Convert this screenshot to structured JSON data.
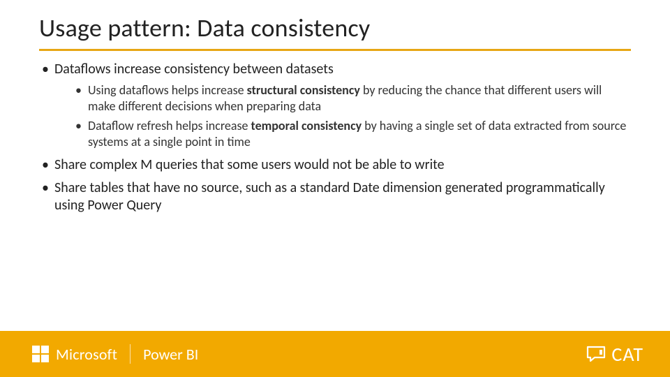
{
  "title": "Usage pattern: Data consistency",
  "bullets": {
    "a": "Dataflows increase consistency between datasets",
    "a1_pre": "Using dataflows helps increase ",
    "a1_bold": "structural consistency",
    "a1_post": " by reducing the chance that different users will make different decisions when preparing data",
    "a2_pre": "Dataflow refresh helps increase ",
    "a2_bold": "temporal consistency",
    "a2_post": " by having a single set of data extracted from source systems at a single point in time",
    "b": "Share complex M queries that some users would not be able to write",
    "c": "Share tables that have no source, such as a standard Date dimension generated programmatically using Power Query"
  },
  "footer": {
    "microsoft": "Microsoft",
    "powerbi": "Power BI",
    "cat": "CAT"
  }
}
